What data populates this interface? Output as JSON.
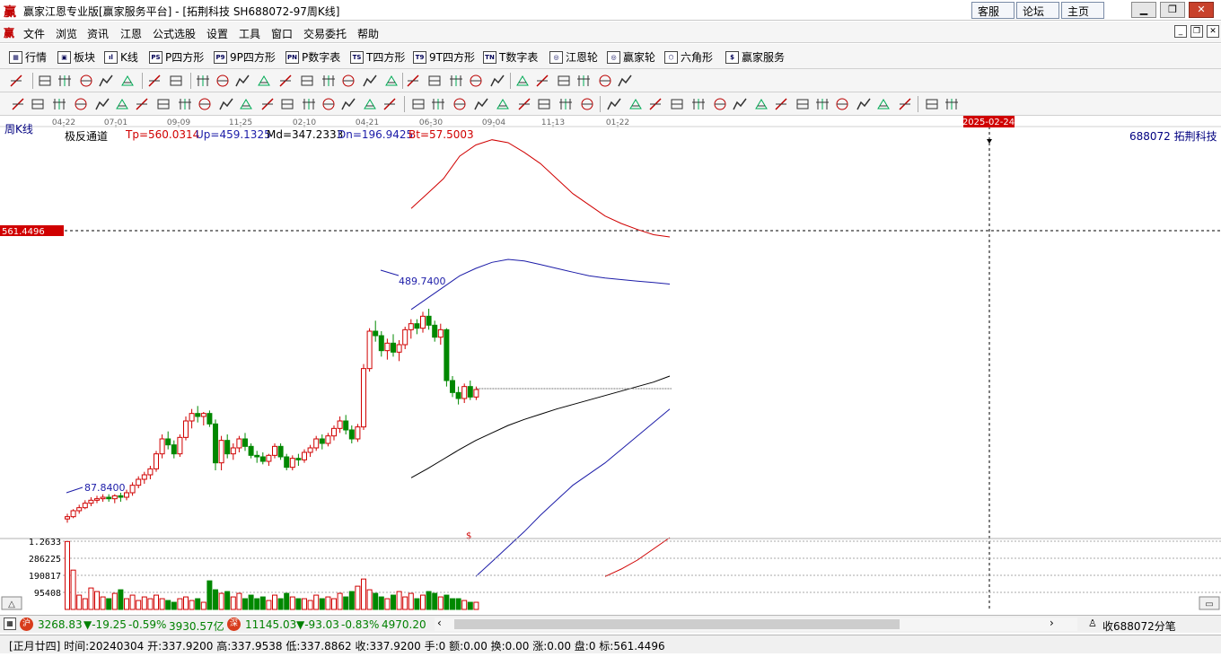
{
  "window": {
    "title": "赢家江恩专业版[赢家服务平台] - [拓荆科技  SH688072-97周K线]",
    "links": [
      "客服",
      "论坛",
      "主页"
    ]
  },
  "menu": [
    "文件",
    "浏览",
    "资讯",
    "江恩",
    "公式选股",
    "设置",
    "工具",
    "窗口",
    "交易委托",
    "帮助"
  ],
  "func_toolbar": [
    {
      "label": "行情",
      "icon": "table-icon",
      "glyph": "▦"
    },
    {
      "label": "板块",
      "icon": "grid-icon",
      "glyph": "▣"
    },
    {
      "label": "K线",
      "icon": "candle-icon",
      "glyph": "ıl"
    },
    {
      "label": "P四方形",
      "icon": "ps-icon",
      "glyph": "PS"
    },
    {
      "label": "9P四方形",
      "icon": "p9-icon",
      "glyph": "P9"
    },
    {
      "label": "P数字表",
      "icon": "pn-icon",
      "glyph": "PN"
    },
    {
      "label": "T四方形",
      "icon": "ts-icon",
      "glyph": "TS"
    },
    {
      "label": "9T四方形",
      "icon": "t9-icon",
      "glyph": "T9"
    },
    {
      "label": "T数字表",
      "icon": "tn-icon",
      "glyph": "TN"
    },
    {
      "label": "江恩轮",
      "icon": "gann-wheel-icon",
      "glyph": "◎"
    },
    {
      "label": "赢家轮",
      "icon": "winner-wheel-icon",
      "glyph": "◎"
    },
    {
      "label": "六角形",
      "icon": "hexagon-icon",
      "glyph": "⬡"
    },
    {
      "label": "赢家服务",
      "icon": "dollar-icon",
      "glyph": "$"
    }
  ],
  "chart": {
    "period_label": "周K线",
    "indicator_name": "极反通道",
    "params": [
      {
        "text": "Tp=560.0314",
        "color": "#d00000"
      },
      {
        "text": "Up=459.1325",
        "color": "#1c1ca8"
      },
      {
        "text": "Md=347.2333",
        "color": "#000000"
      },
      {
        "text": "Dn=196.9425",
        "color": "#1c1ca8"
      },
      {
        "text": "Bt=57.5003",
        "color": "#d00000"
      }
    ],
    "stock_label": "688072  拓荆科技",
    "date_ticks": [
      "04-22",
      "07-01",
      "09-09",
      "11-25",
      "02-10",
      "04-21",
      "06-30",
      "09-04",
      "11-13",
      "01-22"
    ],
    "cursor_date": "2025-02-24",
    "cursor_price": "561.4496",
    "high_annot": "489.7400",
    "low_annot": "87.8400",
    "dollar_mark": "$",
    "volume_labels": [
      "1.2633",
      "286225",
      "190817",
      "95408"
    ]
  },
  "chart_data": {
    "type": "candlestick",
    "period": "weekly",
    "y_range": [
      60,
      600
    ],
    "candles": [
      [
        85,
        92,
        80,
        88
      ],
      [
        88,
        98,
        86,
        96
      ],
      [
        96,
        104,
        92,
        100
      ],
      [
        100,
        110,
        98,
        106
      ],
      [
        106,
        114,
        102,
        110
      ],
      [
        110,
        116,
        106,
        112
      ],
      [
        112,
        118,
        108,
        114
      ],
      [
        114,
        118,
        108,
        112
      ],
      [
        112,
        118,
        106,
        116
      ],
      [
        116,
        120,
        108,
        114
      ],
      [
        114,
        124,
        110,
        120
      ],
      [
        120,
        134,
        116,
        130
      ],
      [
        130,
        142,
        126,
        138
      ],
      [
        138,
        148,
        132,
        144
      ],
      [
        144,
        156,
        138,
        152
      ],
      [
        152,
        176,
        148,
        172
      ],
      [
        172,
        198,
        166,
        192
      ],
      [
        192,
        202,
        178,
        184
      ],
      [
        184,
        190,
        166,
        172
      ],
      [
        172,
        198,
        168,
        194
      ],
      [
        194,
        222,
        190,
        216
      ],
      [
        216,
        232,
        206,
        226
      ],
      [
        226,
        236,
        214,
        222
      ],
      [
        222,
        228,
        210,
        226
      ],
      [
        226,
        230,
        208,
        212
      ],
      [
        212,
        218,
        150,
        160
      ],
      [
        160,
        196,
        150,
        190
      ],
      [
        190,
        198,
        166,
        172
      ],
      [
        172,
        186,
        164,
        180
      ],
      [
        180,
        196,
        174,
        192
      ],
      [
        192,
        200,
        176,
        182
      ],
      [
        182,
        186,
        166,
        170
      ],
      [
        170,
        176,
        160,
        168
      ],
      [
        168,
        174,
        158,
        162
      ],
      [
        162,
        172,
        156,
        170
      ],
      [
        170,
        186,
        166,
        182
      ],
      [
        182,
        186,
        164,
        168
      ],
      [
        168,
        172,
        150,
        154
      ],
      [
        154,
        170,
        150,
        166
      ],
      [
        166,
        172,
        156,
        164
      ],
      [
        164,
        178,
        160,
        174
      ],
      [
        174,
        184,
        168,
        180
      ],
      [
        180,
        196,
        176,
        192
      ],
      [
        192,
        198,
        178,
        186
      ],
      [
        186,
        200,
        182,
        196
      ],
      [
        196,
        210,
        190,
        206
      ],
      [
        206,
        222,
        200,
        216
      ],
      [
        216,
        224,
        198,
        204
      ],
      [
        204,
        210,
        186,
        192
      ],
      [
        192,
        212,
        188,
        208
      ],
      [
        208,
        292,
        204,
        286
      ],
      [
        286,
        340,
        282,
        336
      ],
      [
        336,
        350,
        322,
        330
      ],
      [
        330,
        336,
        302,
        310
      ],
      [
        310,
        326,
        298,
        320
      ],
      [
        320,
        332,
        302,
        308
      ],
      [
        308,
        324,
        296,
        318
      ],
      [
        318,
        342,
        312,
        338
      ],
      [
        338,
        352,
        326,
        346
      ],
      [
        346,
        352,
        332,
        340
      ],
      [
        340,
        362,
        334,
        356
      ],
      [
        356,
        366,
        338,
        344
      ],
      [
        344,
        350,
        322,
        328
      ],
      [
        328,
        346,
        318,
        338
      ],
      [
        338,
        340,
        262,
        270
      ],
      [
        270,
        276,
        248,
        254
      ],
      [
        254,
        262,
        238,
        246
      ],
      [
        246,
        266,
        240,
        262
      ],
      [
        262,
        270,
        244,
        248
      ],
      [
        248,
        262,
        244,
        258
      ]
    ],
    "volume_max": 381634,
    "volume_labels": [
      95408,
      190817,
      286225
    ],
    "volumes": [
      380000,
      220000,
      80000,
      60000,
      120000,
      100000,
      70000,
      60000,
      90000,
      110000,
      60000,
      80000,
      50000,
      70000,
      60000,
      80000,
      60000,
      50000,
      40000,
      60000,
      70000,
      50000,
      60000,
      40000,
      160000,
      110000,
      90000,
      100000,
      70000,
      90000,
      60000,
      80000,
      60000,
      70000,
      50000,
      80000,
      60000,
      90000,
      70000,
      60000,
      60000,
      50000,
      80000,
      60000,
      70000,
      60000,
      90000,
      70000,
      100000,
      130000,
      170000,
      110000,
      90000,
      70000,
      60000,
      80000,
      100000,
      70000,
      90000,
      60000,
      80000,
      100000,
      90000,
      70000,
      80000,
      60000,
      60000,
      50000,
      40000,
      40000
    ],
    "lines": [
      {
        "name": "Tp",
        "color": "#d00000",
        "points": [
          [
            0,
            500
          ],
          [
            10,
            520
          ],
          [
            20,
            540
          ],
          [
            30,
            570
          ],
          [
            40,
            585
          ],
          [
            50,
            592
          ],
          [
            60,
            588
          ],
          [
            70,
            575
          ],
          [
            80,
            560
          ],
          [
            90,
            540
          ],
          [
            100,
            520
          ],
          [
            110,
            505
          ],
          [
            120,
            490
          ],
          [
            130,
            480
          ],
          [
            140,
            472
          ],
          [
            150,
            465
          ],
          [
            160,
            462
          ]
        ]
      },
      {
        "name": "Up",
        "color": "#1c1ca8",
        "points": [
          [
            0,
            365
          ],
          [
            10,
            380
          ],
          [
            20,
            395
          ],
          [
            30,
            410
          ],
          [
            40,
            420
          ],
          [
            50,
            428
          ],
          [
            60,
            432
          ],
          [
            70,
            430
          ],
          [
            80,
            425
          ],
          [
            90,
            420
          ],
          [
            100,
            415
          ],
          [
            110,
            410
          ],
          [
            120,
            407
          ],
          [
            130,
            405
          ],
          [
            140,
            403
          ],
          [
            150,
            401
          ],
          [
            160,
            399
          ]
        ]
      },
      {
        "name": "Md",
        "color": "#000000",
        "points": [
          [
            0,
            140
          ],
          [
            10,
            152
          ],
          [
            20,
            165
          ],
          [
            30,
            178
          ],
          [
            40,
            190
          ],
          [
            50,
            200
          ],
          [
            60,
            210
          ],
          [
            70,
            218
          ],
          [
            80,
            225
          ],
          [
            90,
            232
          ],
          [
            100,
            238
          ],
          [
            110,
            244
          ],
          [
            120,
            250
          ],
          [
            130,
            256
          ],
          [
            140,
            262
          ],
          [
            150,
            268
          ],
          [
            160,
            276
          ]
        ]
      },
      {
        "name": "Dn",
        "color": "#1c1ca8",
        "points": [
          [
            40,
            8
          ],
          [
            50,
            28
          ],
          [
            60,
            48
          ],
          [
            70,
            68
          ],
          [
            80,
            90
          ],
          [
            90,
            110
          ],
          [
            100,
            130
          ],
          [
            110,
            145
          ],
          [
            120,
            160
          ],
          [
            130,
            178
          ],
          [
            140,
            196
          ],
          [
            150,
            214
          ],
          [
            160,
            232
          ]
        ]
      },
      {
        "name": "Bt",
        "color": "#d00000",
        "points": [
          [
            120,
            8
          ],
          [
            130,
            18
          ],
          [
            140,
            30
          ],
          [
            150,
            45
          ],
          [
            160,
            60
          ]
        ]
      }
    ]
  },
  "index_bar": {
    "sh": {
      "price": "3268.83",
      "chg": "▼-19.25",
      "pct": "-0.59%",
      "amt": "3930.57亿"
    },
    "sz": {
      "price": "11145.03",
      "chg": "▼-93.03",
      "pct": "-0.83%",
      "amt": "4970.20"
    },
    "tick_label": "收688072分笔"
  },
  "status_bar": {
    "text": "[正月廿四] 时间:20240304 开:337.9200 高:337.9538 低:337.8862 收:337.9200 手:0 额:0.00 换:0.00 涨:0.00 盘:0 标:561.4496"
  }
}
